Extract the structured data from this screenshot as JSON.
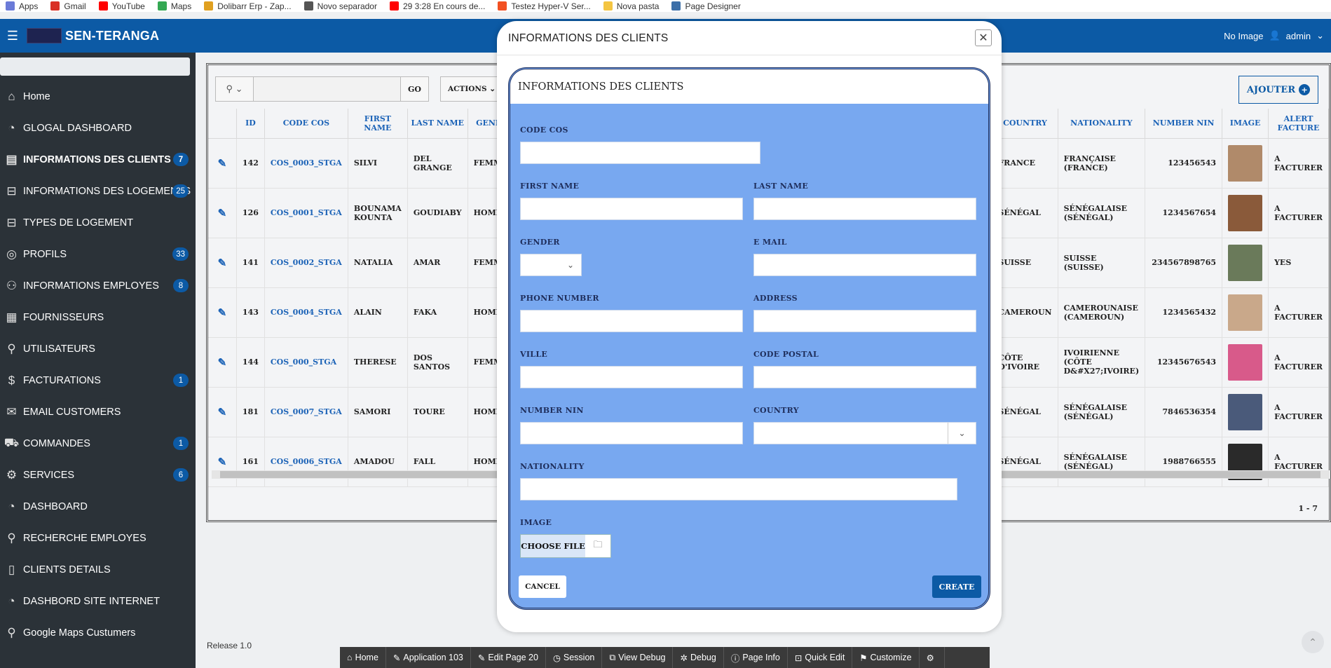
{
  "bookmarks": [
    {
      "label": "Apps",
      "icon": "apps-grid-icon",
      "color": "#6b7bd8"
    },
    {
      "label": "Gmail",
      "icon": "gmail-icon",
      "color": "#d93025"
    },
    {
      "label": "YouTube",
      "icon": "youtube-icon",
      "color": "#ff0000"
    },
    {
      "label": "Maps",
      "icon": "maps-pin-icon",
      "color": "#34a853"
    },
    {
      "label": "Dolibarr Erp - Zap...",
      "icon": "dolibarr-icon",
      "color": "#e0a020"
    },
    {
      "label": "Novo separador",
      "icon": "globe-icon",
      "color": "#555555"
    },
    {
      "label": "29 3:28 En cours de...",
      "icon": "youtube-icon",
      "color": "#ff0000"
    },
    {
      "label": "Testez Hyper-V Ser...",
      "icon": "windows-icon",
      "color": "#f25022"
    },
    {
      "label": "Nova pasta",
      "icon": "folder-icon",
      "color": "#f4c542"
    },
    {
      "label": "Page Designer",
      "icon": "page-designer-icon",
      "color": "#3c6fa8"
    }
  ],
  "header": {
    "app_title": "SEN-TERANGA",
    "no_image": "No Image",
    "user": "admin"
  },
  "sidebar": {
    "items": [
      {
        "label": "Home",
        "icon": "home-icon",
        "badge": ""
      },
      {
        "label": "GLOGAL DASHBOARD",
        "icon": "dashboard-gauge-icon",
        "badge": ""
      },
      {
        "label": "INFORMATIONS DES CLIENTS",
        "icon": "id-card-icon",
        "badge": "7"
      },
      {
        "label": "INFORMATIONS DES LOGEMENTS",
        "icon": "bed-icon",
        "badge": "25"
      },
      {
        "label": "TYPES DE LOGEMENT",
        "icon": "bed-icon",
        "badge": ""
      },
      {
        "label": "PROFILS",
        "icon": "profile-icon",
        "badge": "33"
      },
      {
        "label": "INFORMATIONS EMPLOYES",
        "icon": "users-icon",
        "badge": "8"
      },
      {
        "label": "FOURNISSEURS",
        "icon": "supplier-icon",
        "badge": ""
      },
      {
        "label": "UTILISATEURS",
        "icon": "user-icon",
        "badge": ""
      },
      {
        "label": "FACTURATIONS",
        "icon": "dollar-icon",
        "badge": "1"
      },
      {
        "label": "EMAIL CUSTOMERS",
        "icon": "mail-icon",
        "badge": ""
      },
      {
        "label": "COMMANDES",
        "icon": "cart-icon",
        "badge": "1"
      },
      {
        "label": "SERVICES",
        "icon": "gears-icon",
        "badge": "6"
      },
      {
        "label": "DASHBOARD",
        "icon": "dashboard-gauge-icon",
        "badge": ""
      },
      {
        "label": "RECHERCHE EMPLOYES",
        "icon": "search-icon",
        "badge": ""
      },
      {
        "label": "CLIENTS DETAILS",
        "icon": "document-icon",
        "badge": ""
      },
      {
        "label": "DASHBORD SITE INTERNET",
        "icon": "dashboard-gauge-icon",
        "badge": ""
      },
      {
        "label": "Google Maps Custumers",
        "icon": "map-pin-icon",
        "badge": ""
      }
    ]
  },
  "report": {
    "go_label": "GO",
    "actions_label": "ACTIONS",
    "add_label": "AJOUTER",
    "columns_left": [
      "ID",
      "CODE COS",
      "FIRST NAME",
      "LAST NAME",
      "GEND"
    ],
    "columns_right": [
      "COUNTRY",
      "NATIONALITY",
      "NUMBER NIN",
      "IMAGE",
      "ALERT FACTURE"
    ],
    "rows": [
      {
        "id": "142",
        "code": "COS_0003_STGA",
        "first": "SILVI",
        "last": "DEL GRANGE",
        "gender": "FEMM",
        "country": "FRANCE",
        "nationality": "FRANÇAISE (FRANCE)",
        "nin": "123456543",
        "alert": "A FACTURER",
        "thumb": "#b08a6a"
      },
      {
        "id": "126",
        "code": "COS_0001_STGA",
        "first": "BOUNAMA KOUNTA",
        "last": "GOUDIABY",
        "gender": "HOMM",
        "country": "SÉNÉGAL",
        "nationality": "SÉNÉGALAISE (SÉNÉGAL)",
        "nin": "1234567654",
        "alert": "A FACTURER",
        "thumb": "#8a5a3a"
      },
      {
        "id": "141",
        "code": "COS_0002_STGA",
        "first": "NATALIA",
        "last": "AMAR",
        "gender": "FEMM",
        "country": "SUISSE",
        "nationality": "SUISSE (SUISSE)",
        "nin": "234567898765",
        "alert": "YES",
        "thumb": "#6a7a5a"
      },
      {
        "id": "143",
        "code": "COS_0004_STGA",
        "first": "ALAIN",
        "last": "FAKA",
        "gender": "HOMM",
        "country": "CAMEROUN",
        "nationality": "CAMEROUNAISE (CAMEROUN)",
        "nin": "1234565432",
        "alert": "A FACTURER",
        "thumb": "#c9a88a"
      },
      {
        "id": "144",
        "code": "COS_000_STGA",
        "first": "THERESE",
        "last": "DOS SANTOS",
        "gender": "FEMM",
        "country": "CÔTE D'IVOIRE",
        "nationality": "IVOIRIENNE (CÔTE D&#X27;IVOIRE)",
        "nin": "12345676543",
        "alert": "A FACTURER",
        "thumb": "#d85a8a"
      },
      {
        "id": "181",
        "code": "COS_0007_STGA",
        "first": "SAMORI",
        "last": "TOURE",
        "gender": "HOMM",
        "country": "SÉNÉGAL",
        "nationality": "SÉNÉGALAISE (SÉNÉGAL)",
        "nin": "7846536354",
        "alert": "A FACTURER",
        "thumb": "#4a5a7a"
      },
      {
        "id": "161",
        "code": "COS_0006_STGA",
        "first": "AMADOU",
        "last": "FALL",
        "gender": "HOMM",
        "country": "SÉNÉGAL",
        "nationality": "SÉNÉGALAISE (SÉNÉGAL)",
        "nin": "1988766555",
        "alert": "A FACTURER",
        "thumb": "#2a2a2a"
      }
    ],
    "pagination": "1 - 7"
  },
  "footer": {
    "release": "Release 1.0"
  },
  "devbar": {
    "items": [
      {
        "label": "Home",
        "icon": "home-icon"
      },
      {
        "label": "Application 103",
        "icon": "pencil-icon"
      },
      {
        "label": "Edit Page 20",
        "icon": "edit-page-icon"
      },
      {
        "label": "Session",
        "icon": "session-icon"
      },
      {
        "label": "View Debug",
        "icon": "view-debug-icon"
      },
      {
        "label": "Debug",
        "icon": "bug-icon"
      },
      {
        "label": "Page Info",
        "icon": "info-icon"
      },
      {
        "label": "Quick Edit",
        "icon": "quick-edit-icon"
      },
      {
        "label": "Customize",
        "icon": "customize-icon"
      },
      {
        "label": "",
        "icon": "gear-icon"
      }
    ]
  },
  "dialog": {
    "title": "INFORMATIONS DES CLIENTS",
    "region_title": "INFORMATIONS DES CLIENTS",
    "fields": {
      "code_cos": "CODE COS",
      "first_name": "FIRST NAME",
      "last_name": "LAST NAME",
      "gender": "GENDER",
      "email": "E MAIL",
      "phone": "PHONE NUMBER",
      "address": "ADDRESS",
      "ville": "VILLE",
      "code_postal": "CODE POSTAL",
      "number_nin": "NUMBER NIN",
      "country": "COUNTRY",
      "nationality": "NATIONALITY",
      "image": "IMAGE"
    },
    "choose_file": "CHOOSE FILE",
    "cancel": "CANCEL",
    "create": "CREATE"
  },
  "colors": {
    "brand": "#0c5aa5",
    "sidebar": "#2b3238",
    "region": "#78a8f0",
    "link": "#1c63b7"
  }
}
